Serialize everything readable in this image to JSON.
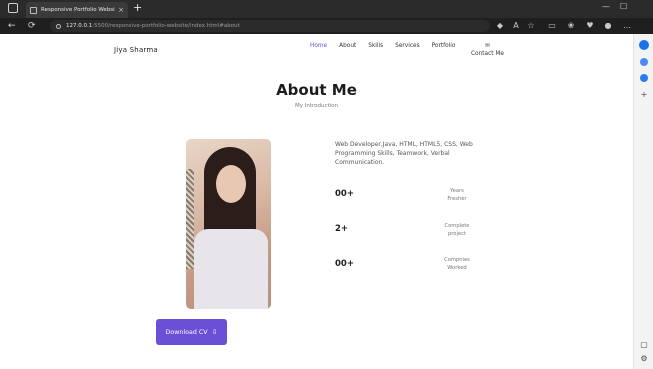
{
  "browser": {
    "tab_title": "Responsive Portfolio Website",
    "tab_close": "×",
    "new_tab": "+",
    "url_host": "127.0.0.1",
    "url_rest": ":5500/responsive-portfolio-website/index.html#about",
    "back": "←",
    "refresh": "⟳",
    "minimize": "—",
    "maximize": "☐",
    "toolbar_icons": [
      "extension-icon",
      "read-aloud-icon",
      "favorites-star-icon",
      "collections-icon",
      "favorites-icon",
      "profile-icon",
      "more-icon"
    ]
  },
  "page": {
    "brand": "Jiya Sharma",
    "nav": {
      "home": "Home",
      "about": "About",
      "skills": "Skills",
      "services": "Services",
      "portfolio": "Portfolio",
      "contact_glyph": "✉",
      "contact": "Contact Me"
    },
    "section_title": "About Me",
    "section_subtitle": "My Introduction",
    "description": "Web Developer,Java, HTML, HTML5, CSS, Web Programming Skills, Teamwork, Verbal Communication.",
    "stats": [
      {
        "value": "00+",
        "label_line1": "Years",
        "label_line2": "Fresher"
      },
      {
        "value": "2+",
        "label_line1": "Complete",
        "label_line2": "project"
      },
      {
        "value": "00+",
        "label_line1": "Compnies",
        "label_line2": "Worked"
      }
    ],
    "download_button": "Download CV",
    "download_icon": "⇩"
  },
  "colors": {
    "accent": "#6b4fd6",
    "active_nav": "#6a4fd8",
    "browser_dark": "#2b2b2b"
  }
}
